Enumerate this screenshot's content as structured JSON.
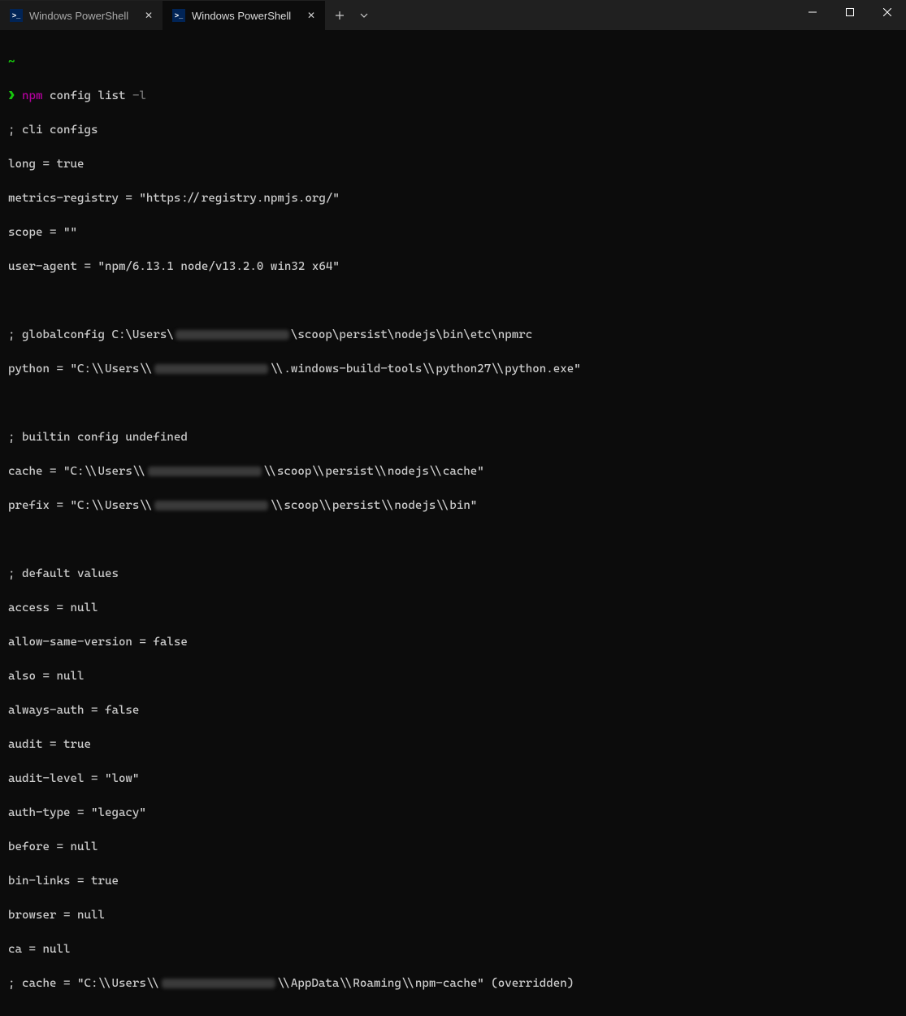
{
  "tabs": [
    {
      "title": "Windows PowerShell",
      "active": false
    },
    {
      "title": "Windows PowerShell",
      "active": true
    }
  ],
  "prompt": {
    "tilde": "~",
    "arrow": "❯",
    "command": "npm",
    "args": "config list",
    "flag": "-l"
  },
  "output": {
    "cli_header": "; cli configs",
    "long": "long = true",
    "metrics": "metrics-registry = \"https://registry.npmjs.org/\"",
    "scope": "scope = \"\"",
    "useragent": "user-agent = \"npm/6.13.1 node/v13.2.0 win32 x64\"",
    "globalconfig_pre": "; globalconfig C:\\Users\\",
    "globalconfig_post": "\\scoop\\persist\\nodejs\\bin\\etc\\npmrc",
    "python_pre": "python = \"C:\\\\Users\\\\",
    "python_post": "\\\\.windows-build-tools\\\\python27\\\\python.exe\"",
    "builtin_header": "; builtin config undefined",
    "cache_pre": "cache = \"C:\\\\Users\\\\",
    "cache_post": "\\\\scoop\\\\persist\\\\nodejs\\\\cache\"",
    "prefix_pre": "prefix = \"C:\\\\Users\\\\",
    "prefix_post": "\\\\scoop\\\\persist\\\\nodejs\\\\bin\"",
    "default_header": "; default values",
    "access": "access = null",
    "allow_same": "allow-same-version = false",
    "also": "also = null",
    "always_auth": "always-auth = false",
    "audit": "audit = true",
    "audit_level": "audit-level = \"low\"",
    "auth_type": "auth-type = \"legacy\"",
    "before": "before = null",
    "bin_links": "bin-links = true",
    "browser": "browser = null",
    "ca": "ca = null",
    "cache2_pre": "; cache = \"C:\\\\Users\\\\",
    "cache2_post": "\\\\AppData\\\\Roaming\\\\npm-cache\" (overridden)"
  }
}
